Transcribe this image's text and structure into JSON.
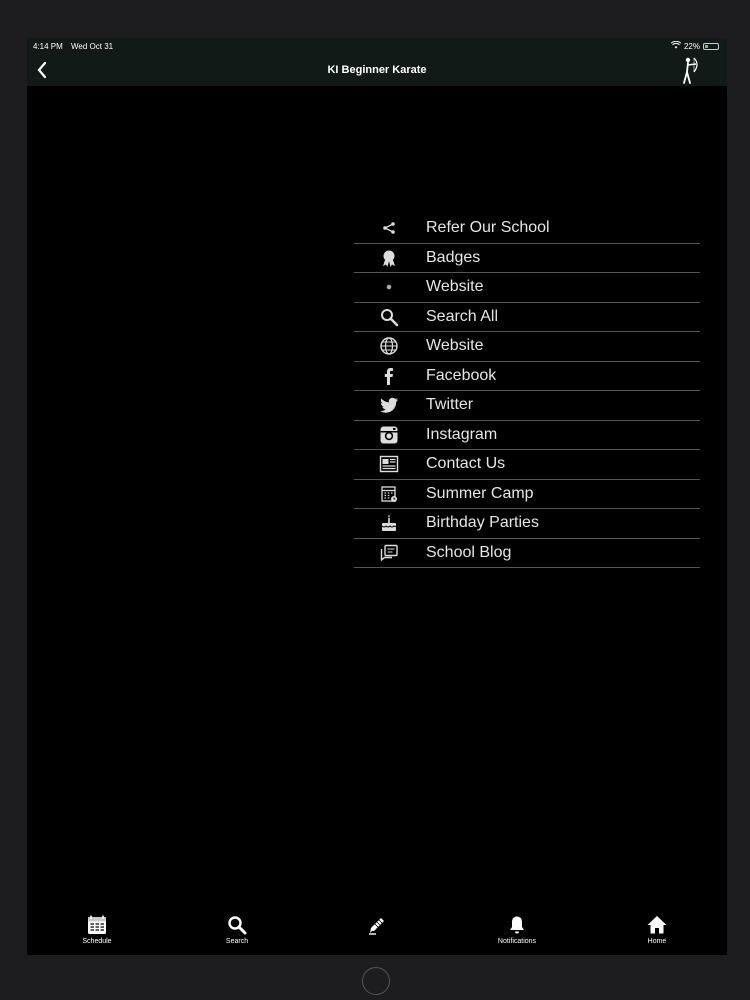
{
  "status": {
    "time": "4:14 PM",
    "date": "Wed Oct 31",
    "battery": "22%"
  },
  "nav": {
    "title": "KI Beginner Karate"
  },
  "menu": [
    {
      "label": "Refer Our School",
      "icon": "share-icon"
    },
    {
      "label": "Badges",
      "icon": "badge-icon"
    },
    {
      "label": "Website",
      "icon": "dot-icon"
    },
    {
      "label": "Search All",
      "icon": "search-icon"
    },
    {
      "label": "Website",
      "icon": "globe-icon"
    },
    {
      "label": "Facebook",
      "icon": "facebook-icon"
    },
    {
      "label": "Twitter",
      "icon": "twitter-icon"
    },
    {
      "label": "Instagram",
      "icon": "instagram-icon"
    },
    {
      "label": "Contact Us",
      "icon": "contact-icon"
    },
    {
      "label": "Summer Camp",
      "icon": "calendar-icon"
    },
    {
      "label": "Birthday Parties",
      "icon": "cake-icon"
    },
    {
      "label": "School Blog",
      "icon": "blog-icon"
    }
  ],
  "tabs": [
    {
      "label": "Schedule",
      "icon": "schedule-icon"
    },
    {
      "label": "Search",
      "icon": "search-icon"
    },
    {
      "label": "",
      "icon": "pencil-icon"
    },
    {
      "label": "Notifications",
      "icon": "bell-icon"
    },
    {
      "label": "Home",
      "icon": "home-icon"
    }
  ]
}
